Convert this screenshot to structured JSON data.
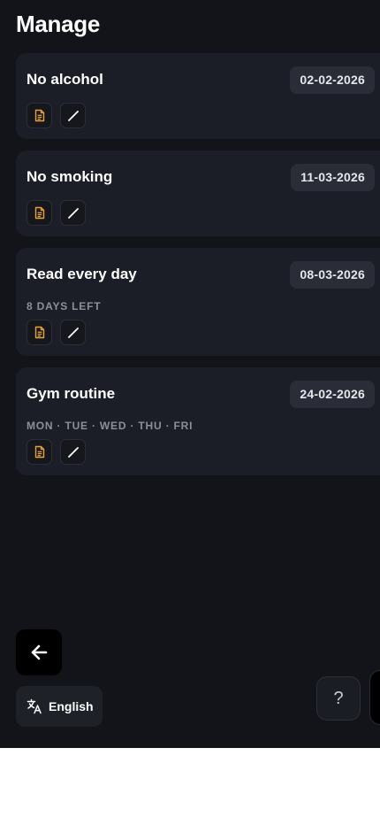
{
  "header": {
    "title": "Manage"
  },
  "habits": [
    {
      "name": "No alcohol",
      "date": "02-02-2026",
      "subtitle": ""
    },
    {
      "name": "No smoking",
      "date": "11-03-2026",
      "subtitle": ""
    },
    {
      "name": "Read every day",
      "date": "08-03-2026",
      "subtitle": "8 DAYS LEFT"
    },
    {
      "name": "Gym routine",
      "date": "24-02-2026",
      "subtitle": "MON · TUE · WED · THU · FRI"
    }
  ],
  "footer": {
    "language_label": "English",
    "help_label": "?"
  },
  "icons": {
    "notes": "document-icon",
    "edit": "pencil-icon",
    "back": "arrow-left-icon",
    "language": "translate-icon"
  },
  "colors": {
    "app_background": "#131419",
    "card_background": "#1c1e27",
    "date_pill": "#2a2d38",
    "notes_icon": "#e8a23c",
    "subtitle": "#8b8f9c"
  }
}
